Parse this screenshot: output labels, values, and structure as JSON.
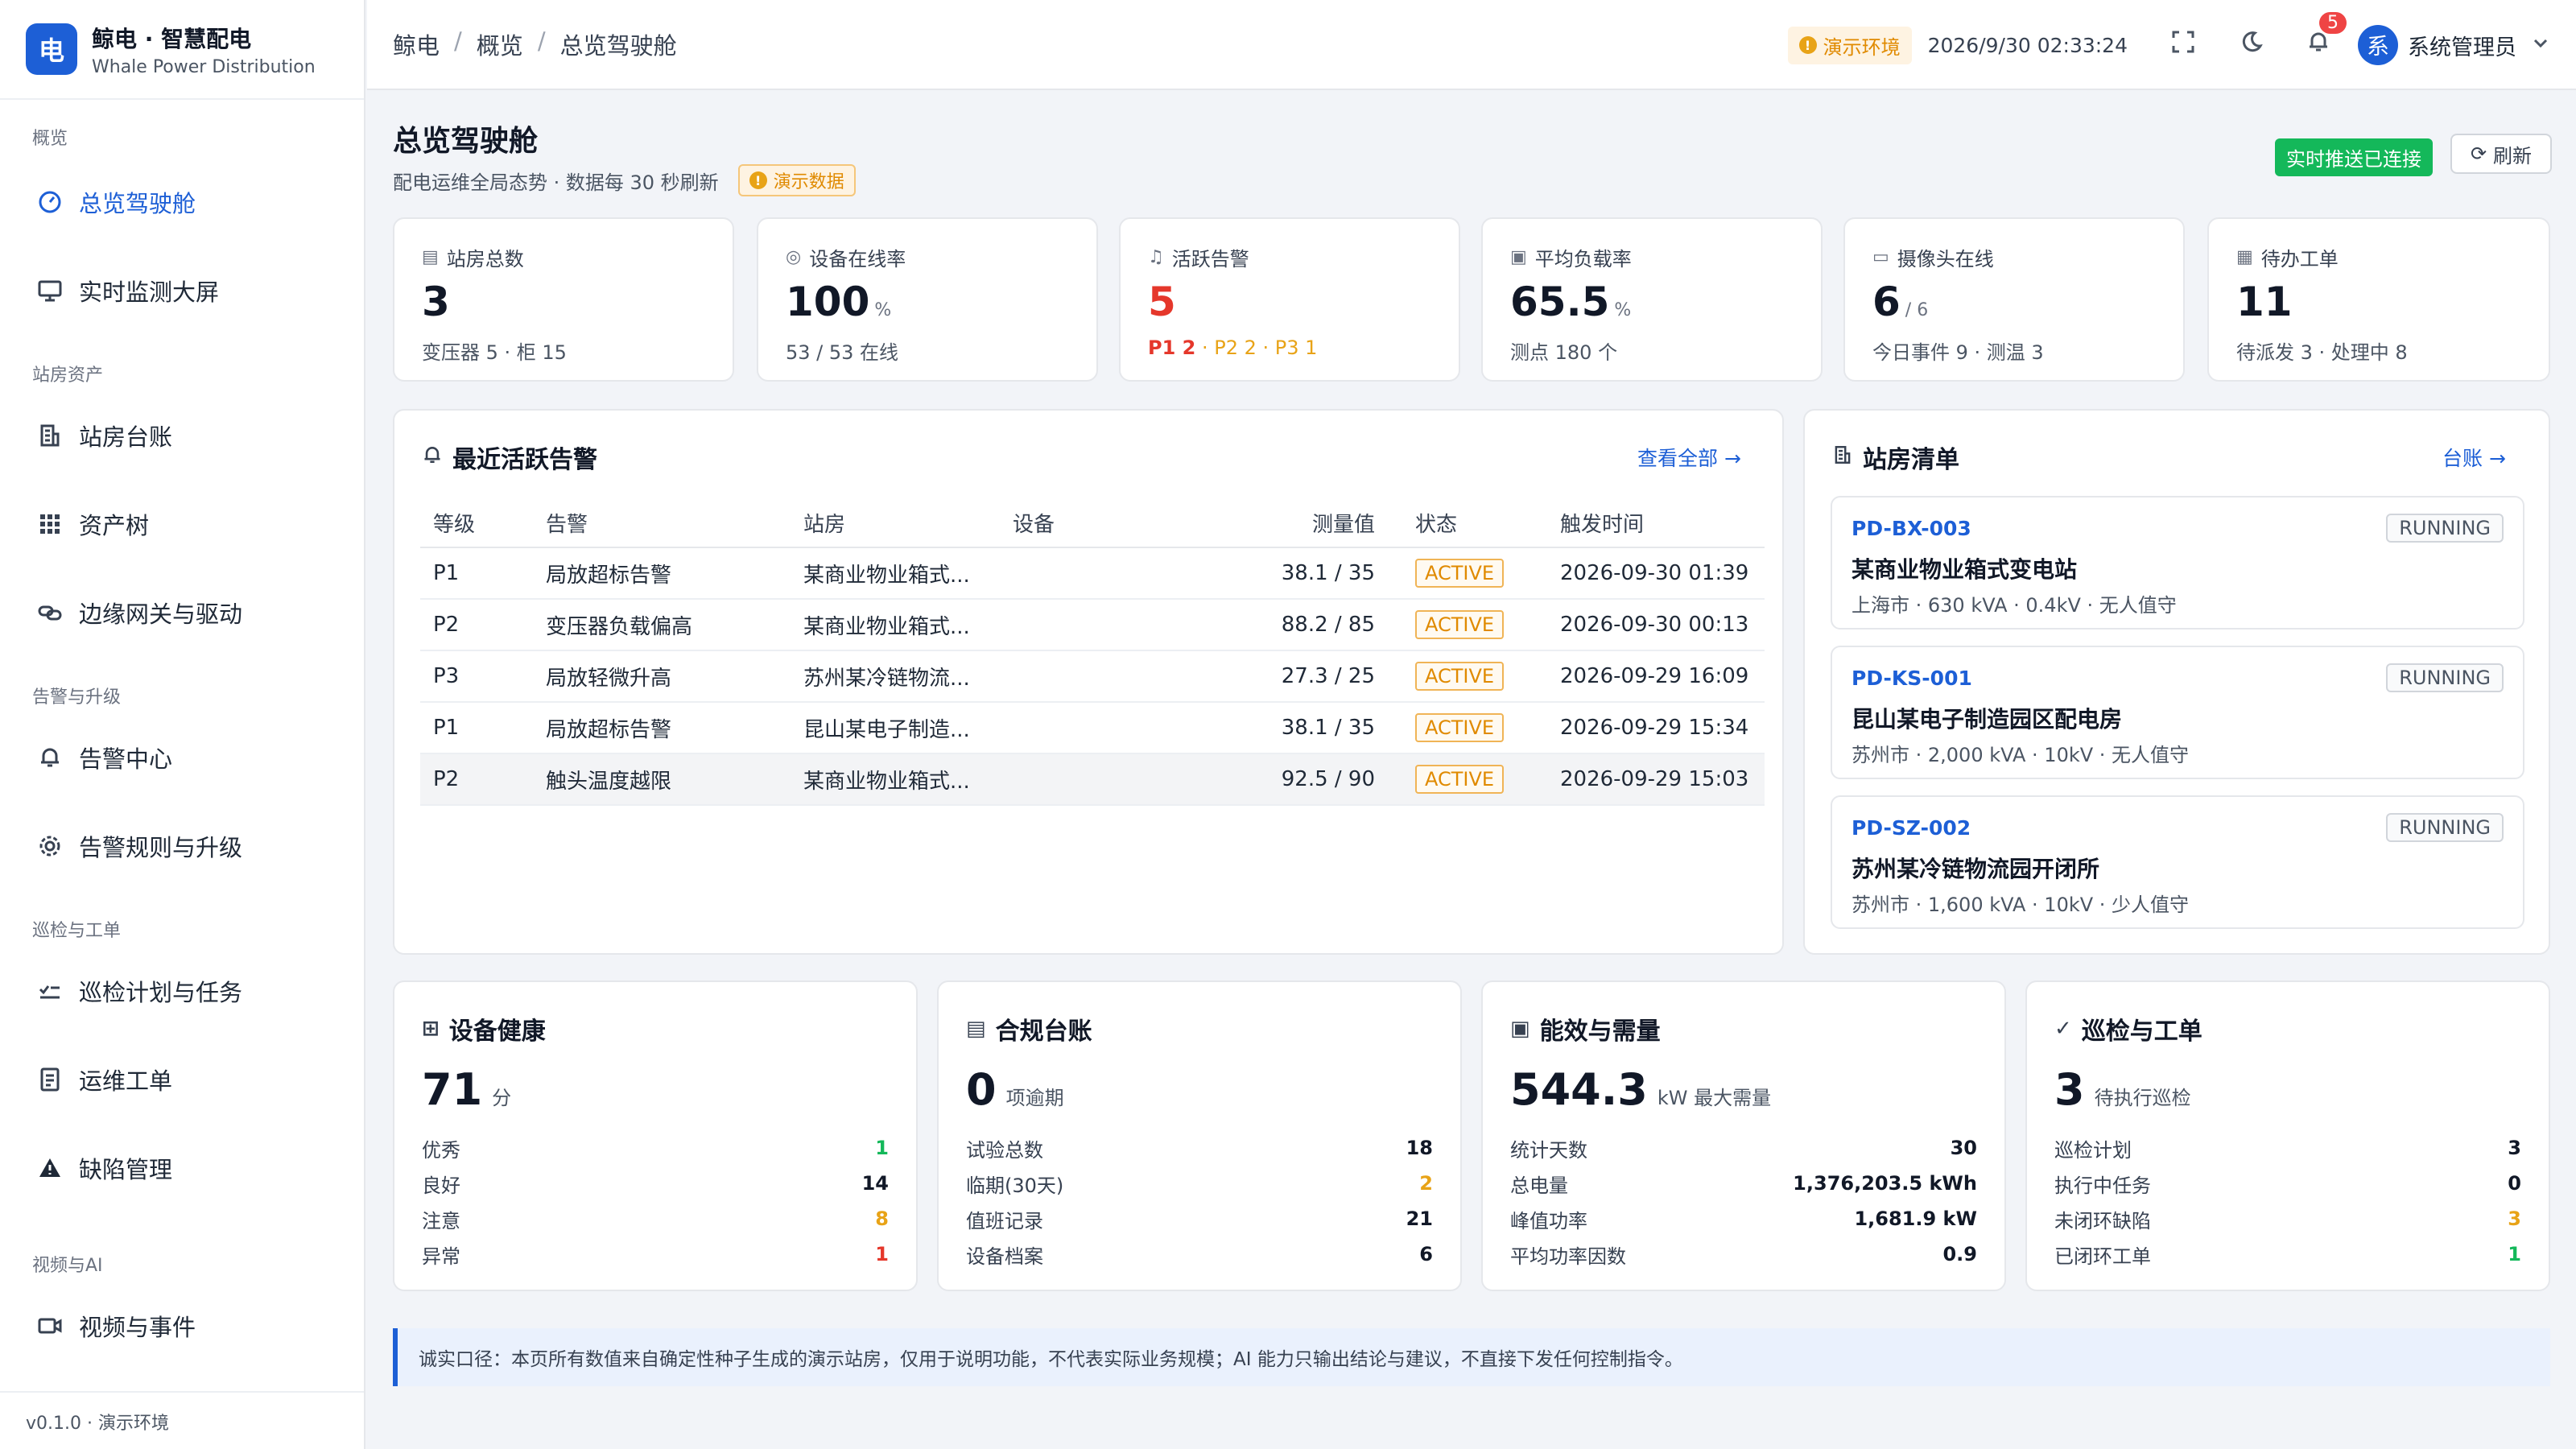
{
  "brand": {
    "logo": "电",
    "name": "鲸电 · 智慧配电",
    "sub": "Whale Power Distribution"
  },
  "sidebar": {
    "groups": [
      "概览",
      "站房资产",
      "告警与升级",
      "巡检与工单",
      "视频与AI"
    ],
    "items": [
      {
        "label": "总览驾驶舱",
        "icon": "dashboard-icon"
      },
      {
        "label": "实时监测大屏",
        "icon": "monitor-icon"
      },
      {
        "label": "站房台账",
        "icon": "building-icon"
      },
      {
        "label": "资产树",
        "icon": "grid-icon"
      },
      {
        "label": "边缘网关与驱动",
        "icon": "link-icon"
      },
      {
        "label": "告警中心",
        "icon": "bell-icon"
      },
      {
        "label": "告警规则与升级",
        "icon": "gear-icon"
      },
      {
        "label": "巡检计划与任务",
        "icon": "checklist-icon"
      },
      {
        "label": "运维工单",
        "icon": "document-icon"
      },
      {
        "label": "缺陷管理",
        "icon": "warning-icon"
      },
      {
        "label": "视频与事件",
        "icon": "video-icon"
      }
    ],
    "footer": "v0.1.0 · 演示环境"
  },
  "header": {
    "breadcrumbs": [
      "鲸电",
      "概览",
      "总览驾驶舱"
    ],
    "env": "演示环境",
    "datetime": "2026/9/30 02:33:24",
    "notifications": "5",
    "avatar": "系",
    "user": "系统管理员"
  },
  "page": {
    "title": "总览驾驶舱",
    "subtitle": "配电运维全局态势 · 数据每 30 秒刷新",
    "demo_tag": "演示数据",
    "live_status": "实时推送已连接",
    "refresh": "刷新"
  },
  "stats": [
    {
      "label": "站房总数",
      "icon": "building-icon",
      "value": "3",
      "unit": "",
      "foot": "变压器 5 · 柜 15"
    },
    {
      "label": "设备在线率",
      "icon": "chip-icon",
      "value": "100",
      "unit": "%",
      "foot": "53 / 53 在线"
    },
    {
      "label": "活跃告警",
      "icon": "bell-icon",
      "value": "5",
      "unit": "",
      "foot_p1": "P1 2",
      "foot_rest": " · P2 2 · P3 1"
    },
    {
      "label": "平均负载率",
      "icon": "chart-icon",
      "value": "65.5",
      "unit": "%",
      "foot": "测点 180 个"
    },
    {
      "label": "摄像头在线",
      "icon": "camera-icon",
      "value": "6",
      "unit": "/ 6",
      "foot": "今日事件 9 · 测温 3"
    },
    {
      "label": "待办工单",
      "icon": "document-icon",
      "value": "11",
      "unit": "",
      "foot": "待派发 3 · 处理中 8"
    }
  ],
  "alarms": {
    "title": "最近活跃告警",
    "link": "查看全部 →",
    "columns": [
      "等级",
      "告警",
      "站房",
      "设备",
      "测量值",
      "状态",
      "触发时间"
    ],
    "rows": [
      {
        "level": "P1",
        "name": "局放超标告警",
        "station": "某商业物业箱式...",
        "device": "",
        "value": "38.1 / 35",
        "status": "ACTIVE",
        "time": "2026-09-30 01:39"
      },
      {
        "level": "P2",
        "name": "变压器负载偏高",
        "station": "某商业物业箱式...",
        "device": "",
        "value": "88.2 / 85",
        "status": "ACTIVE",
        "time": "2026-09-30 00:13"
      },
      {
        "level": "P3",
        "name": "局放轻微升高",
        "station": "苏州某冷链物流...",
        "device": "",
        "value": "27.3 / 25",
        "status": "ACTIVE",
        "time": "2026-09-29 16:09"
      },
      {
        "level": "P1",
        "name": "局放超标告警",
        "station": "昆山某电子制造...",
        "device": "",
        "value": "38.1 / 35",
        "status": "ACTIVE",
        "time": "2026-09-29 15:34"
      },
      {
        "level": "P2",
        "name": "触头温度越限",
        "station": "某商业物业箱式...",
        "device": "",
        "value": "92.5 / 90",
        "status": "ACTIVE",
        "time": "2026-09-29 15:03"
      }
    ]
  },
  "stations": {
    "title": "站房清单",
    "link": "台账 →",
    "items": [
      {
        "code": "PD-BX-003",
        "name": "某商业物业箱式变电站",
        "meta": "上海市 · 630 kVA · 0.4kV · 无人值守",
        "status": "RUNNING"
      },
      {
        "code": "PD-KS-001",
        "name": "昆山某电子制造园区配电房",
        "meta": "苏州市 · 2,000 kVA · 10kV · 无人值守",
        "status": "RUNNING"
      },
      {
        "code": "PD-SZ-002",
        "name": "苏州某冷链物流园开闭所",
        "meta": "苏州市 · 1,600 kVA · 10kV · 少人值守",
        "status": "RUNNING"
      }
    ]
  },
  "health": {
    "title": "设备健康",
    "value": "71",
    "unit": "分",
    "rows": [
      {
        "k": "优秀",
        "v": "1",
        "c": "green"
      },
      {
        "k": "良好",
        "v": "14",
        "c": ""
      },
      {
        "k": "注意",
        "v": "8",
        "c": "amber"
      },
      {
        "k": "异常",
        "v": "1",
        "c": "red"
      }
    ]
  },
  "compliance": {
    "title": "合规台账",
    "value": "0",
    "unit": "项逾期",
    "rows": [
      {
        "k": "试验总数",
        "v": "18",
        "c": ""
      },
      {
        "k": "临期(30天)",
        "v": "2",
        "c": "amber"
      },
      {
        "k": "值班记录",
        "v": "21",
        "c": ""
      },
      {
        "k": "设备档案",
        "v": "6",
        "c": ""
      }
    ]
  },
  "energy": {
    "title": "能效与需量",
    "value": "544.3",
    "unit": "kW 最大需量",
    "rows": [
      {
        "k": "统计天数",
        "v": "30",
        "c": ""
      },
      {
        "k": "总电量",
        "v": "1,376,203.5 kWh",
        "c": ""
      },
      {
        "k": "峰值功率",
        "v": "1,681.9 kW",
        "c": ""
      },
      {
        "k": "平均功率因数",
        "v": "0.9",
        "c": ""
      }
    ]
  },
  "inspection": {
    "title": "巡检与工单",
    "value": "3",
    "unit": "待执行巡检",
    "rows": [
      {
        "k": "巡检计划",
        "v": "3",
        "c": ""
      },
      {
        "k": "执行中任务",
        "v": "0",
        "c": ""
      },
      {
        "k": "未闭环缺陷",
        "v": "3",
        "c": "amber"
      },
      {
        "k": "已闭环工单",
        "v": "1",
        "c": "green"
      }
    ]
  },
  "note": "诚实口径：本页所有数值来自确定性种子生成的演示站房，仅用于说明功能，不代表实际业务规模；AI 能力只输出结论与建议，不直接下发任何控制指令。"
}
